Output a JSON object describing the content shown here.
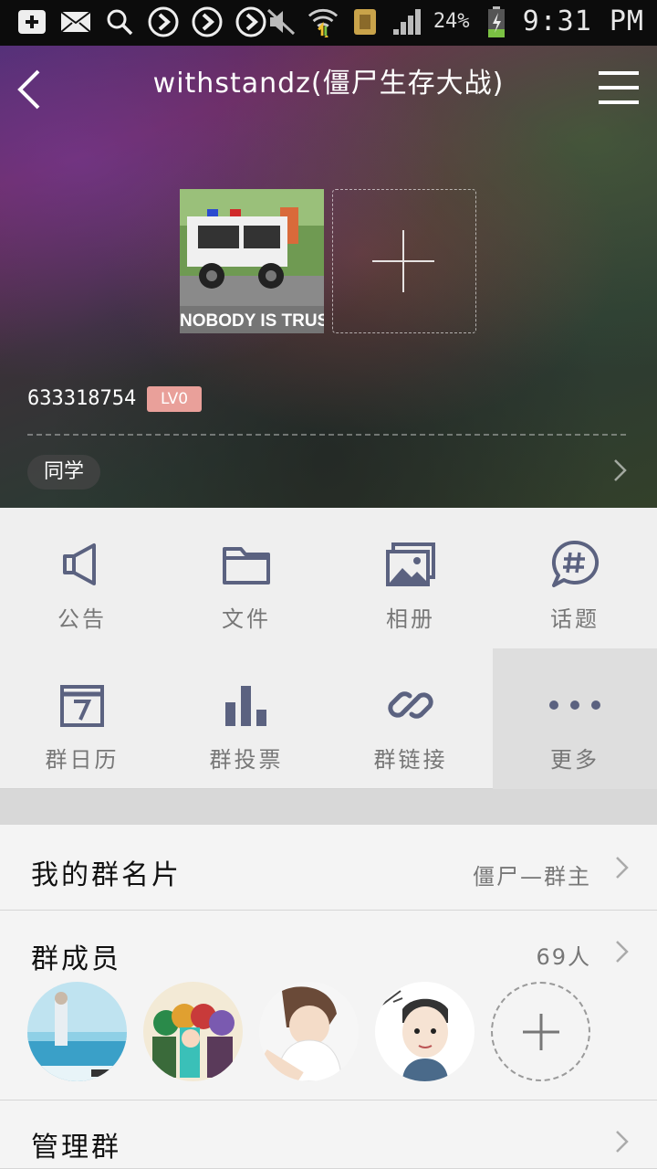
{
  "status_bar": {
    "battery_percent": "24%",
    "time": "9:31 PM",
    "icons": [
      "add-box-icon",
      "mail-icon",
      "search-icon",
      "play-circle-icon",
      "play-circle-icon",
      "play-circle-icon",
      "mute-icon",
      "wifi-icon",
      "app-notification-icon",
      "signal-icon",
      "battery-charging-icon"
    ]
  },
  "header": {
    "title": "withstandz(僵尸生存大战)",
    "back_icon": "chevron-left-icon",
    "menu_icon": "hamburger-menu-icon"
  },
  "hero": {
    "photo_caption": "NOBODY IS TRUST",
    "group_id": "633318754",
    "level_badge": "LV0",
    "tag": "同学"
  },
  "actions": [
    {
      "label": "公告",
      "icon": "megaphone-icon"
    },
    {
      "label": "文件",
      "icon": "folder-icon"
    },
    {
      "label": "相册",
      "icon": "photo-album-icon"
    },
    {
      "label": "话题",
      "icon": "hashtag-chat-icon"
    },
    {
      "label": "群日历",
      "icon": "calendar-icon"
    },
    {
      "label": "群投票",
      "icon": "bar-chart-icon"
    },
    {
      "label": "群链接",
      "icon": "link-icon"
    },
    {
      "label": "更多",
      "icon": "more-dots-icon"
    }
  ],
  "rows": {
    "my_card": {
      "title": "我的群名片",
      "value": "僵尸—群主"
    },
    "members": {
      "title": "群成员",
      "count": "69人"
    },
    "manage": {
      "title": "管理群"
    }
  },
  "colors": {
    "icon": "#5b6280",
    "level_badge": "#e9a09a"
  }
}
